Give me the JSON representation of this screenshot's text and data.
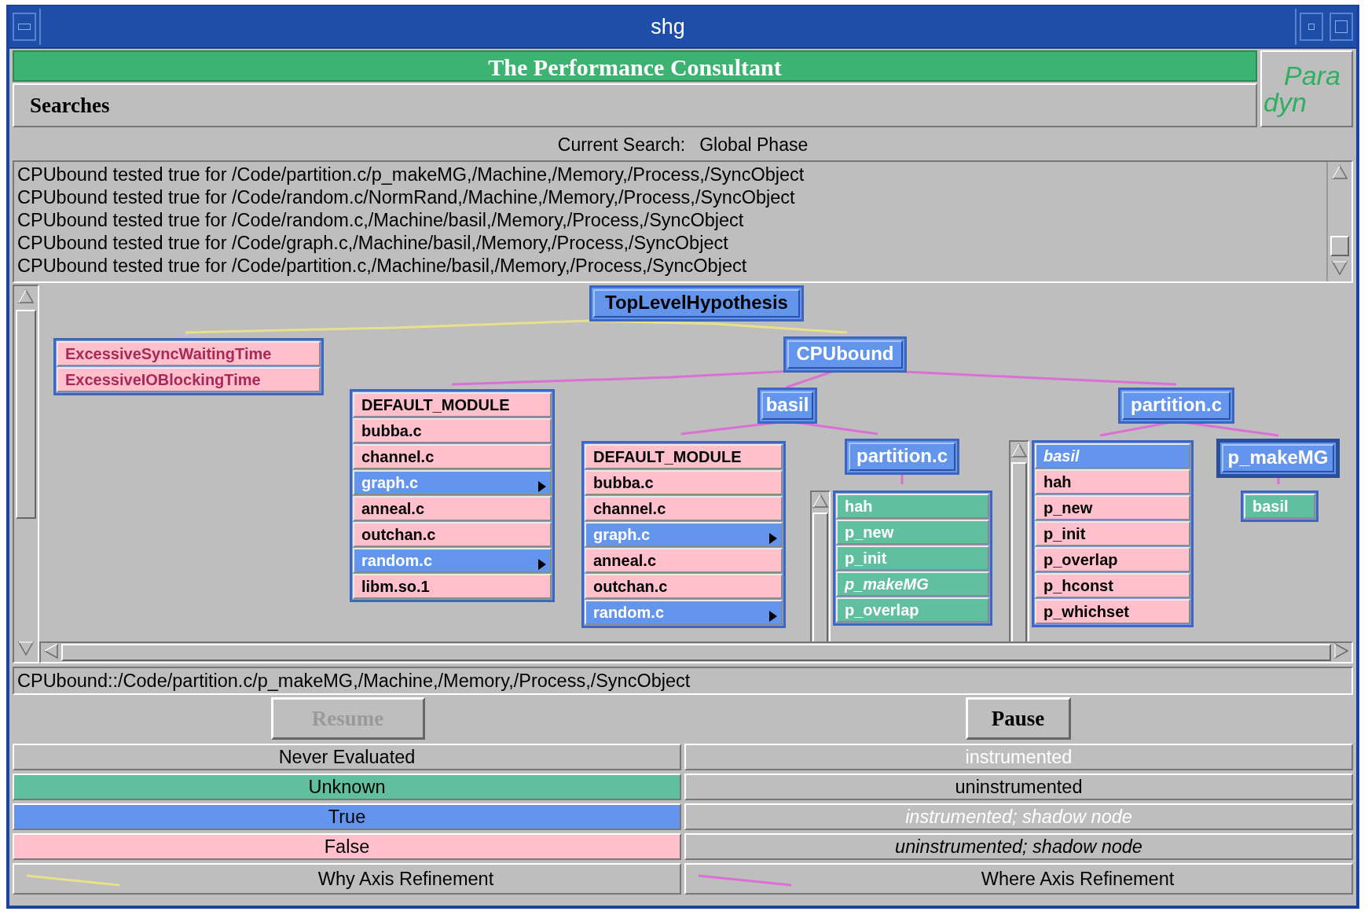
{
  "window": {
    "title": "shg"
  },
  "header": {
    "title": "The Performance Consultant",
    "searches_label": "Searches",
    "logo_top": "Para",
    "logo_bottom": "dyn"
  },
  "current_search": {
    "label": "Current Search:",
    "value": "Global Phase"
  },
  "messages": [
    "CPUbound tested true for /Code/partition.c/p_makeMG,/Machine,/Memory,/Process,/SyncObject",
    "CPUbound tested true for /Code/random.c/NormRand,/Machine,/Memory,/Process,/SyncObject",
    "CPUbound tested true for /Code/random.c,/Machine/basil,/Memory,/Process,/SyncObject",
    "CPUbound tested true for /Code/graph.c,/Machine/basil,/Memory,/Process,/SyncObject",
    "CPUbound tested true for /Code/partition.c,/Machine/basil,/Memory,/Process,/SyncObject"
  ],
  "graph": {
    "nodes": [
      {
        "kind": "node",
        "label": "TopLevelHypothesis",
        "color": "#6495ed",
        "instrumented": false,
        "shadow": false,
        "selected": false
      },
      {
        "kind": "list",
        "scrollbar": false,
        "selected": false,
        "items": [
          {
            "label": "ExcessiveSyncWaitingTime",
            "color": "#ffc0cb",
            "instrumented": true,
            "shadow": false,
            "expandable": false
          },
          {
            "label": "ExcessiveIOBlockingTime",
            "color": "#ffc0cb",
            "instrumented": true,
            "shadow": false,
            "expandable": false
          }
        ]
      },
      {
        "kind": "node",
        "label": "CPUbound",
        "color": "#6495ed",
        "instrumented": true,
        "shadow": false,
        "selected": false
      },
      {
        "kind": "list",
        "scrollbar": false,
        "selected": false,
        "items": [
          {
            "label": "DEFAULT_MODULE",
            "color": "#ffc0cb",
            "instrumented": false,
            "shadow": false,
            "expandable": false
          },
          {
            "label": "bubba.c",
            "color": "#ffc0cb",
            "instrumented": false,
            "shadow": false,
            "expandable": false
          },
          {
            "label": "channel.c",
            "color": "#ffc0cb",
            "instrumented": false,
            "shadow": false,
            "expandable": false
          },
          {
            "label": "graph.c",
            "color": "#6495ed",
            "instrumented": true,
            "shadow": false,
            "expandable": true
          },
          {
            "label": "anneal.c",
            "color": "#ffc0cb",
            "instrumented": false,
            "shadow": false,
            "expandable": false
          },
          {
            "label": "outchan.c",
            "color": "#ffc0cb",
            "instrumented": false,
            "shadow": false,
            "expandable": false
          },
          {
            "label": "random.c",
            "color": "#6495ed",
            "instrumented": true,
            "shadow": false,
            "expandable": true
          },
          {
            "label": "libm.so.1",
            "color": "#ffc0cb",
            "instrumented": false,
            "shadow": false,
            "expandable": false
          }
        ]
      },
      {
        "kind": "node",
        "label": "basil",
        "color": "#6495ed",
        "instrumented": true,
        "shadow": false,
        "selected": false
      },
      {
        "kind": "node",
        "label": "partition.c",
        "color": "#6495ed",
        "instrumented": true,
        "shadow": false,
        "selected": false
      },
      {
        "kind": "list",
        "scrollbar": false,
        "selected": false,
        "items": [
          {
            "label": "DEFAULT_MODULE",
            "color": "#ffc0cb",
            "instrumented": false,
            "shadow": false,
            "expandable": false
          },
          {
            "label": "bubba.c",
            "color": "#ffc0cb",
            "instrumented": false,
            "shadow": false,
            "expandable": false
          },
          {
            "label": "channel.c",
            "color": "#ffc0cb",
            "instrumented": false,
            "shadow": false,
            "expandable": false
          },
          {
            "label": "graph.c",
            "color": "#6495ed",
            "instrumented": true,
            "shadow": false,
            "expandable": true
          },
          {
            "label": "anneal.c",
            "color": "#ffc0cb",
            "instrumented": false,
            "shadow": false,
            "expandable": false
          },
          {
            "label": "outchan.c",
            "color": "#ffc0cb",
            "instrumented": false,
            "shadow": false,
            "expandable": false
          },
          {
            "label": "random.c",
            "color": "#6495ed",
            "instrumented": true,
            "shadow": false,
            "expandable": true
          }
        ]
      },
      {
        "kind": "node",
        "label": "partition.c",
        "color": "#6495ed",
        "instrumented": true,
        "shadow": false,
        "selected": false
      },
      {
        "kind": "list",
        "scrollbar": true,
        "selected": false,
        "items": [
          {
            "label": "hah",
            "color": "#60bf9e",
            "instrumented": true,
            "shadow": false,
            "expandable": false
          },
          {
            "label": "p_new",
            "color": "#60bf9e",
            "instrumented": true,
            "shadow": false,
            "expandable": false
          },
          {
            "label": "p_init",
            "color": "#60bf9e",
            "instrumented": true,
            "shadow": false,
            "expandable": false
          },
          {
            "label": "p_makeMG",
            "color": "#60bf9e",
            "instrumented": true,
            "shadow": true,
            "expandable": false
          },
          {
            "label": "p_overlap",
            "color": "#60bf9e",
            "instrumented": true,
            "shadow": false,
            "expandable": false
          }
        ]
      },
      {
        "kind": "list",
        "scrollbar": true,
        "selected": false,
        "items": [
          {
            "label": "basil",
            "color": "#6495ed",
            "instrumented": true,
            "shadow": true,
            "expandable": false
          },
          {
            "label": "hah",
            "color": "#ffc0cb",
            "instrumented": false,
            "shadow": false,
            "expandable": false
          },
          {
            "label": "p_new",
            "color": "#ffc0cb",
            "instrumented": false,
            "shadow": false,
            "expandable": false
          },
          {
            "label": "p_init",
            "color": "#ffc0cb",
            "instrumented": false,
            "shadow": false,
            "expandable": false
          },
          {
            "label": "p_overlap",
            "color": "#ffc0cb",
            "instrumented": false,
            "shadow": false,
            "expandable": false
          },
          {
            "label": "p_hconst",
            "color": "#ffc0cb",
            "instrumented": false,
            "shadow": false,
            "expandable": false
          },
          {
            "label": "p_whichset",
            "color": "#ffc0cb",
            "instrumented": false,
            "shadow": false,
            "expandable": false
          }
        ]
      },
      {
        "kind": "node",
        "label": "p_makeMG",
        "color": "#6495ed",
        "instrumented": true,
        "shadow": false,
        "selected": true
      },
      {
        "kind": "list",
        "scrollbar": false,
        "selected": false,
        "items": [
          {
            "label": "basil",
            "color": "#60bf9e",
            "instrumented": true,
            "shadow": false,
            "expandable": false
          }
        ]
      }
    ]
  },
  "status_path": "CPUbound::/Code/partition.c/p_makeMG,/Machine,/Memory,/Process,/SyncObject",
  "buttons": [
    {
      "label": "Resume",
      "disabled": true
    },
    {
      "label": "Pause",
      "disabled": false
    }
  ],
  "legend": [
    {
      "left": {
        "kind": "state",
        "label": "Never Evaluated",
        "color": "#bebebe"
      },
      "right": {
        "kind": "style",
        "label": "instrumented",
        "instrumented": true,
        "shadow": false
      }
    },
    {
      "left": {
        "kind": "state",
        "label": "Unknown",
        "color": "#60bf9e"
      },
      "right": {
        "kind": "style",
        "label": "uninstrumented",
        "instrumented": false,
        "shadow": false
      }
    },
    {
      "left": {
        "kind": "state",
        "label": "True",
        "color": "#6495ed"
      },
      "right": {
        "kind": "style",
        "label": "instrumented; shadow node",
        "instrumented": true,
        "shadow": true
      }
    },
    {
      "left": {
        "kind": "state",
        "label": "False",
        "color": "#ffc0cb"
      },
      "right": {
        "kind": "style",
        "label": "uninstrumented; shadow node",
        "instrumented": false,
        "shadow": true
      }
    },
    {
      "left": {
        "kind": "line",
        "label": "Why Axis Refinement",
        "color": "#e8e08a"
      },
      "right": {
        "kind": "line",
        "label": "Where Axis Refinement",
        "color": "#da70d6"
      }
    }
  ]
}
